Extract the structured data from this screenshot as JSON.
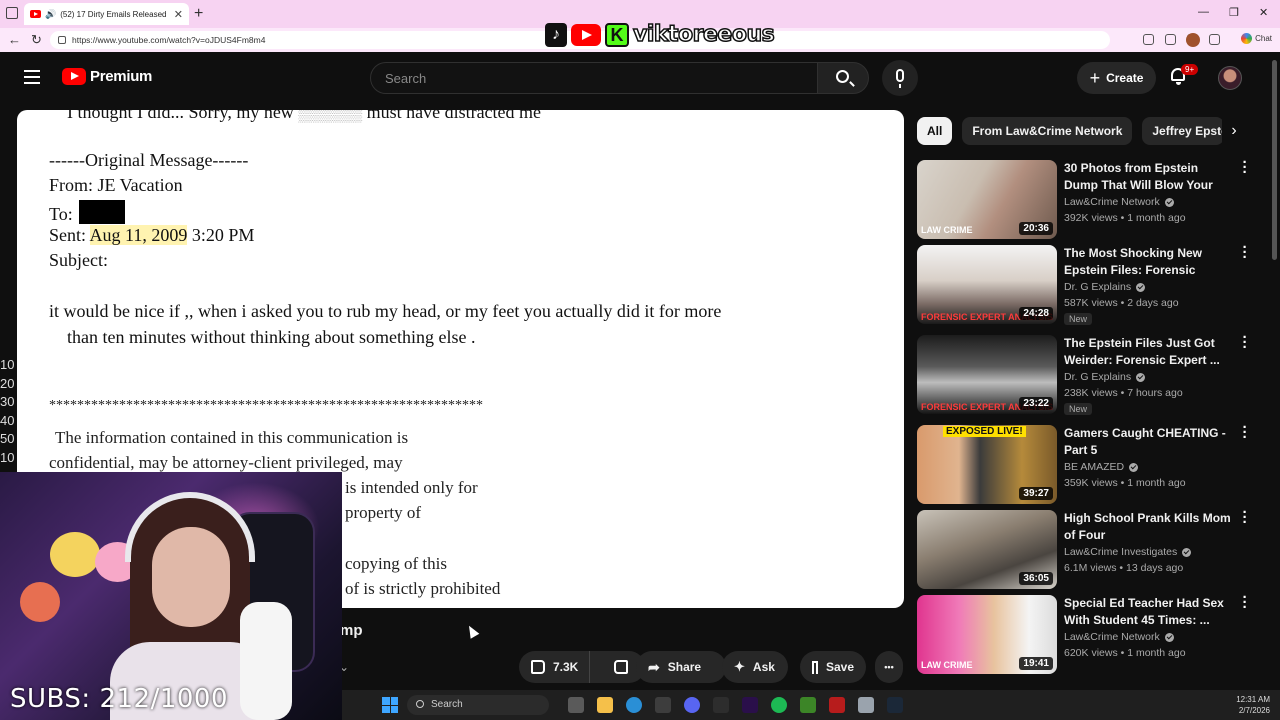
{
  "browser": {
    "tab_title": "(52) 17 Dirty Emails Released",
    "tab_close": "✕",
    "new_tab": "+",
    "url": "https://www.youtube.com/watch?v=oJDUS4Fm8m4",
    "chat_label": "Chat",
    "win_min": "—",
    "win_max": "❐",
    "win_close": "✕"
  },
  "overlay": {
    "kick_letter": "K",
    "streamer_name": "viktoreeous"
  },
  "header": {
    "brand": "Premium",
    "search_placeholder": "Search",
    "create_label": "Create",
    "notif_count": "9+"
  },
  "video_doc": {
    "line_top": "I thought I did... Sorry, my new",
    "line_top_end": "must have distracted me",
    "orig": "------Original Message------",
    "from": "From: JE Vacation",
    "to": "To:",
    "sent_label": "Sent:",
    "sent_date": "Aug 11, 2009",
    "sent_time": "3:20 PM",
    "subject": "Subject:",
    "body1": "it would be nice  if  ,, when i asked you to rub my head, or my feet   you actually did it for more",
    "body2": "than ten  minutes without thinking about something else .",
    "stars": "**************************************************************",
    "legal1": "The information contained in this communication is",
    "legal2": "confidential, may be attorney-client privileged, may",
    "legal3": "is intended only for",
    "legal4": "property of",
    "legal5": "copying of this",
    "legal6": "of is strictly prohibited"
  },
  "left_digits": [
    "10",
    "20",
    "30",
    "40",
    "50",
    "10"
  ],
  "video_info": {
    "title_fragment": "mp",
    "like_count": "7.3K",
    "share_label": "Share",
    "ask_label": "Ask",
    "save_label": "Save",
    "more_label": "•••"
  },
  "chips": [
    "All",
    "From Law&Crime Network",
    "Jeffrey Epstein"
  ],
  "recommendations": [
    {
      "title": "30 Photos from Epstein Dump That Will Blow Your Mind",
      "channel": "Law&Crime Network",
      "meta": "392K views • 1 month ago",
      "duration": "20:36",
      "thumb_text": "LAW CRIME",
      "new": ""
    },
    {
      "title": "The Most Shocking New Epstein Files: Forensic Expert ...",
      "channel": "Dr. G Explains",
      "meta": "587K views • 2 days ago",
      "duration": "24:28",
      "thumb_text": "FORENSIC EXPERT ANALYSIS",
      "new": "New"
    },
    {
      "title": "The Epstein Files Just Got Weirder: Forensic Expert ...",
      "channel": "Dr. G Explains",
      "meta": "238K views • 7 hours ago",
      "duration": "23:22",
      "thumb_text": "FORENSIC EXPERT ANALYSIS",
      "new": "New"
    },
    {
      "title": "Gamers Caught CHEATING - Part 5",
      "channel": "BE AMAZED",
      "meta": "359K views • 1 month ago",
      "duration": "39:27",
      "thumb_text": "EXPOSED LIVE!",
      "new": ""
    },
    {
      "title": "High School Prank Kills Mom of Four",
      "channel": "Law&Crime Investigates",
      "meta": "6.1M views • 13 days ago",
      "duration": "36:05",
      "thumb_text": "",
      "new": ""
    },
    {
      "title": "Special Ed Teacher Had Sex With Student 45 Times: ...",
      "channel": "Law&Crime Network",
      "meta": "620K views • 1 month ago",
      "duration": "19:41",
      "thumb_text": "LAW CRIME",
      "new": ""
    }
  ],
  "webcam": {
    "subs_text": "SUBS: 212/1000"
  },
  "taskbar": {
    "search_label": "Search",
    "time": "12:31 AM",
    "date": "2/7/2026"
  },
  "colors": {
    "brand_red": "#ff0000",
    "bg": "#0f0f0f",
    "chip_bg": "#272727",
    "highlight": "#fff3b0"
  }
}
